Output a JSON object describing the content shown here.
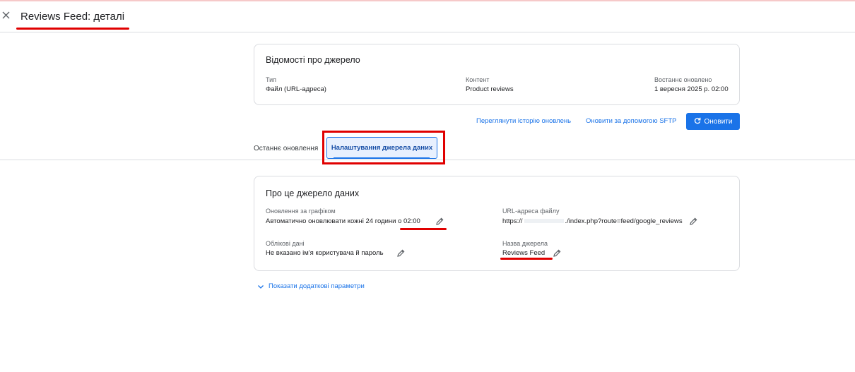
{
  "header": {
    "title": "Reviews Feed: деталі"
  },
  "source_info": {
    "title": "Відомості про джерело",
    "type_label": "Тип",
    "type_value": "Файл (URL-адреса)",
    "content_label": "Контент",
    "content_value": "Product reviews",
    "updated_label": "Востаннє оновлено",
    "updated_value": "1 вересня 2025 р. 02:00"
  },
  "actions": {
    "history_link": "Переглянути історію оновлень",
    "sftp_link": "Оновити за допомогою SFTP",
    "refresh_button": "Оновити"
  },
  "tabs": {
    "recent": "Останнє оновлення",
    "settings": "Налаштування джерела даних"
  },
  "about": {
    "title": "Про це джерело даних",
    "schedule_label": "Оновлення за графіком",
    "schedule_value": "Автоматично оновлювати кожні 24 години о 02:00",
    "url_label": "URL-адреса файлу",
    "url_prefix": "https://",
    "url_suffix": "./index.php?route=feed/google_reviews",
    "credentials_label": "Облікові дані",
    "credentials_value": "Не вказано ім'я користувача й пароль",
    "name_label": "Назва джерела",
    "name_value": "Reviews Feed"
  },
  "more": {
    "label": "Показати додаткові параметри"
  },
  "colors": {
    "accent": "#1a73e8",
    "annotation": "#e00000",
    "border": "#dadce0"
  },
  "icons": [
    "close-icon",
    "refresh-icon",
    "pencil-icon",
    "chevron-down-icon"
  ]
}
